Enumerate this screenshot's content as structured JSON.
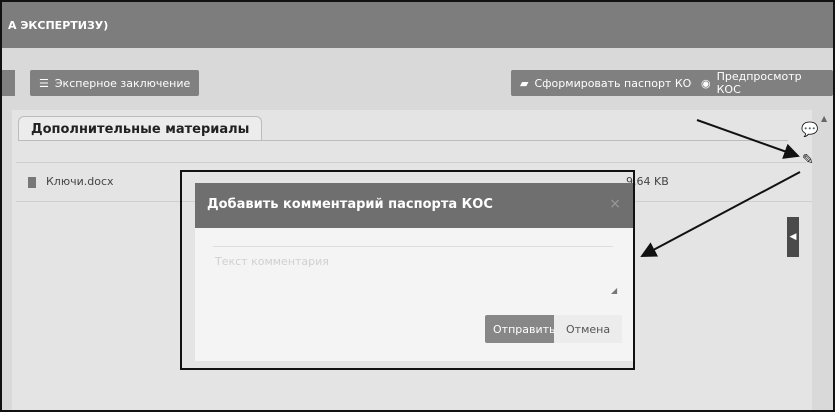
{
  "header": {
    "title": "А ЭКСПЕРТИЗУ)"
  },
  "toolbar": {
    "expert_conclusion_label": "Эксперное заключение",
    "generate_passport_label": "Сформировать паспорт КОС",
    "preview_label": "Предпросмотр КОС"
  },
  "panel": {
    "tab_label": "Дополнительные материалы",
    "files": [
      {
        "name": "Ключи.docx",
        "size": "9.64 KB"
      }
    ]
  },
  "modal": {
    "title": "Добавить комментарий паспорта КОС",
    "close": "×",
    "textarea_placeholder": "Текст комментария",
    "send_label": "Отправить",
    "cancel_label": "Отмена"
  },
  "icons": {
    "list": "list-icon",
    "passport": "document-icon",
    "preview": "eye-icon",
    "comment": "comment-icon",
    "edit": "pencil-icon",
    "file": "file-icon"
  }
}
